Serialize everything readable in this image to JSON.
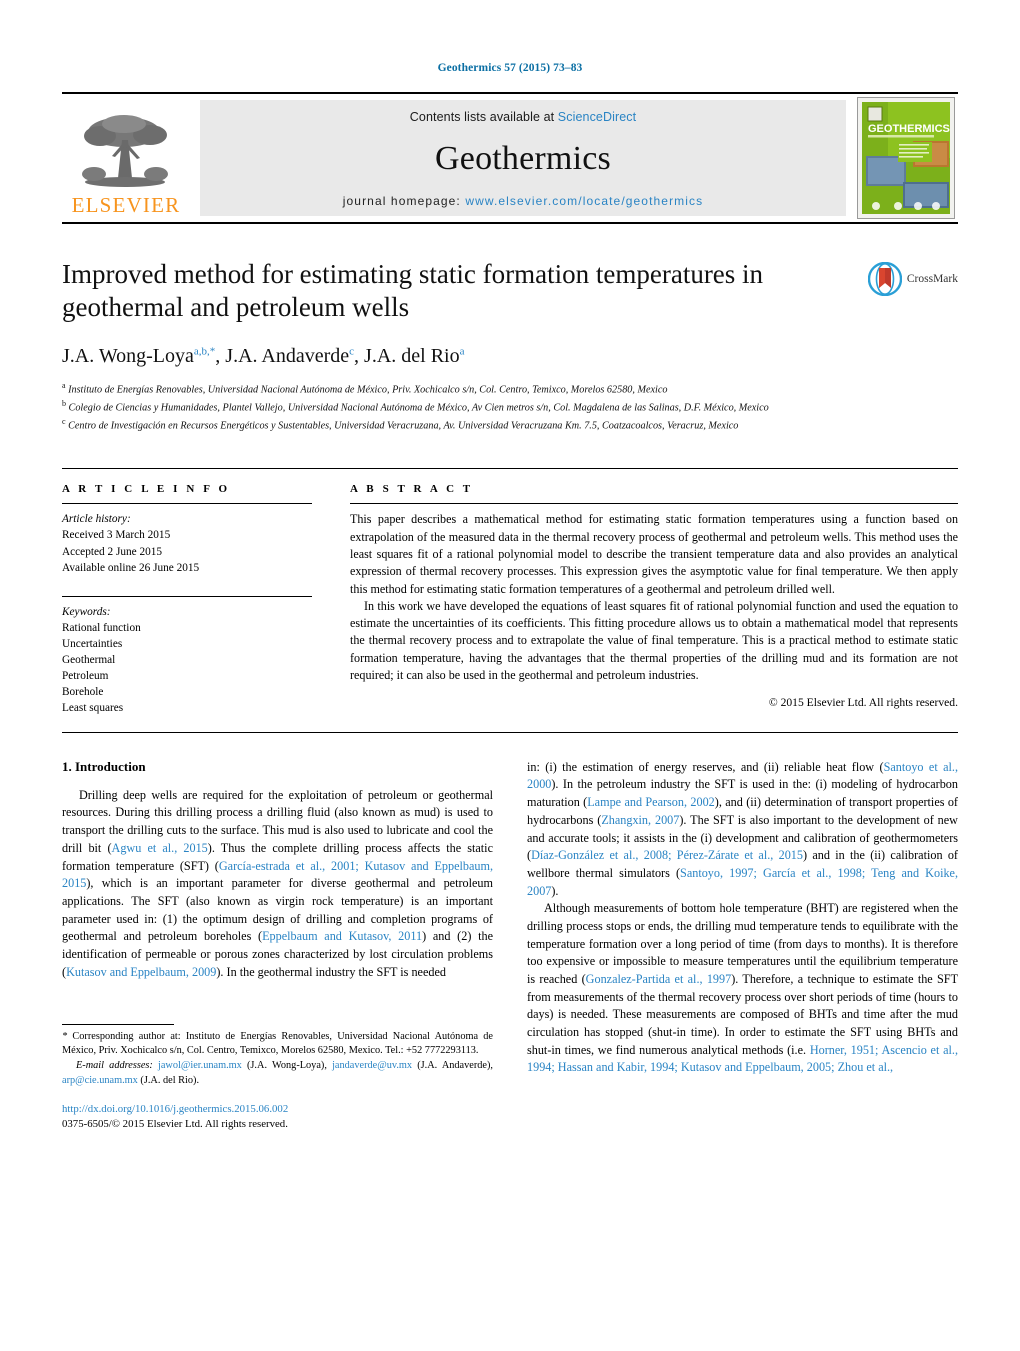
{
  "running_head": "Geothermics 57 (2015) 73–83",
  "masthead": {
    "publisher_name": "ELSEVIER",
    "contents_prefix": "Contents lists available at ",
    "contents_link": "ScienceDirect",
    "journal_name": "Geothermics",
    "homepage_prefix": "journal homepage: ",
    "homepage_url": "www.elsevier.com/locate/geothermics",
    "cover_title": "GEOTHERMICS",
    "accent_blue": "#2a84c4",
    "elsevier_orange": "#f7941e",
    "bar_gray": "#e9e9e9"
  },
  "article": {
    "title": "Improved method for estimating static formation temperatures in geothermal and petroleum wells",
    "authors_html": "J.A. Wong-Loya<sup>a,b,*</sup>, J.A. Andaverde<sup>c</sup>, J.A. del Rio<sup>a</sup>",
    "affiliations": [
      "Instituto de Energías Renovables, Universidad Nacional Autónoma de México, Priv. Xochicalco s/n, Col. Centro, Temixco, Morelos 62580, Mexico",
      "Colegio de Ciencias y Humanidades, Plantel Vallejo, Universidad Nacional Autónoma de México, Av Cien metros s/n, Col. Magdalena de las Salinas, D.F. México, Mexico",
      "Centro de Investigación en Recursos Energéticos y Sustentables, Universidad Veracruzana, Av. Universidad Veracruzana Km. 7.5, Coatzacoalcos, Veracruz, Mexico"
    ],
    "crossmark_label": "CrossMark"
  },
  "article_info": {
    "heading": "A R T I C L E   I N F O",
    "history_label": "Article history:",
    "history": [
      "Received 3 March 2015",
      "Accepted 2 June 2015",
      "Available online 26 June 2015"
    ],
    "keywords_label": "Keywords:",
    "keywords": [
      "Rational function",
      "Uncertainties",
      "Geothermal",
      "Petroleum",
      "Borehole",
      "Least squares"
    ]
  },
  "abstract": {
    "heading": "A B S T R A C T",
    "paragraphs": [
      "This paper describes a mathematical method for estimating static formation temperatures using a function based on extrapolation of the measured data in the thermal recovery process of geothermal and petroleum wells. This method uses the least squares fit of a rational polynomial model to describe the transient temperature data and also provides an analytical expression of thermal recovery processes. This expression gives the asymptotic value for final temperature. We then apply this method for estimating static formation temperatures of a geothermal and petroleum drilled well.",
      "In this work we have developed the equations of least squares fit of rational polynomial function and used the equation to estimate the uncertainties of its coefficients. This fitting procedure allows us to obtain a mathematical model that represents the thermal recovery process and to extrapolate the value of final temperature. This is a practical method to estimate static formation temperature, having the advantages that the thermal properties of the drilling mud and its formation are not required; it can also be used in the geothermal and petroleum industries."
    ],
    "copyright": "© 2015 Elsevier Ltd. All rights reserved."
  },
  "body": {
    "section_heading": "1.  Introduction",
    "left_paragraph_1_html": "Drilling deep wells are required for the exploitation of petroleum or geothermal resources. During this drilling process a drilling fluid (also known as mud) is used to transport the drilling cuts to the surface. This mud is also used to lubricate and cool the drill bit (<span class=\"cite\">Agwu et al., 2015</span>). Thus the complete drilling process affects the static formation temperature (SFT) (<span class=\"cite\">García-estrada et al., 2001; Kutasov and Eppelbaum, 2015</span>), which is an important parameter for diverse geothermal and petroleum applications. The SFT (also known as virgin rock temperature) is an important parameter used in: (1) the optimum design of drilling and completion programs of geothermal and petroleum boreholes (<span class=\"cite\">Eppelbaum and Kutasov, 2011</span>) and (2) the identification of permeable or porous zones characterized by lost circulation problems (<span class=\"cite\">Kutasov and Eppelbaum, 2009</span>). In the geothermal industry the SFT is needed",
    "right_paragraph_1_html": "in: (i) the estimation of energy reserves, and (ii) reliable heat flow (<span class=\"cite\">Santoyo et al., 2000</span>). In the petroleum industry the SFT is used in the: (i) modeling of hydrocarbon maturation (<span class=\"cite\">Lampe and Pearson, 2002</span>), and (ii) determination of transport properties of hydrocarbons (<span class=\"cite\">Zhangxin, 2007</span>). The SFT is also important to the development of new and accurate tools; it assists in the (i) development and calibration of geothermometers (<span class=\"cite\">Díaz-González et al., 2008; Pérez-Zárate et al., 2015</span>) and in the (ii) calibration of wellbore thermal simulators (<span class=\"cite\">Santoyo, 1997; García et al., 1998; Teng and Koike, 2007</span>).",
    "right_paragraph_2_html": "Although measurements of bottom hole temperature (BHT) are registered when the drilling process stops or ends, the drilling mud temperature tends to equilibrate with the temperature formation over a long period of time (from days to months). It is therefore too expensive or impossible to measure temperatures until the equilibrium temperature is reached (<span class=\"cite\">Gonzalez-Partida et al., 1997</span>). Therefore, a technique to estimate the SFT from measurements of the thermal recovery process over short periods of time (hours to days) is needed. These measurements are composed of BHTs and time after the mud circulation has stopped (shut-in time). In order to estimate the SFT using BHTs and shut-in times, we find numerous analytical methods (i.e. <span class=\"cite\">Horner, 1951; Ascencio et al., 1994; Hassan and Kabir, 1994; Kutasov and Eppelbaum, 2005; Zhou et al.,</span>"
  },
  "footnote": {
    "corresponding_html": "<span class=\"em-label\">*</span> Corresponding author at: Instituto de Energías Renovables, Universidad Nacional Autónoma de México, Priv. Xochicalco s/n, Col. Centro, Temixco, Morelos 62580, Mexico. Tel.: +52 7772293113.",
    "emails_html": "<span class=\"em-label\">E-mail addresses:</span> <span class=\"cite\">jawol@ier.unam.mx</span> (J.A. Wong-Loya), <span class=\"cite\">jandaverde@uv.mx</span> (J.A. Andaverde), <span class=\"cite\">arp@cie.unam.mx</span> (J.A. del Rio).",
    "doi": "http://dx.doi.org/10.1016/j.geothermics.2015.06.002",
    "issn": "0375-6505/© 2015 Elsevier Ltd. All rights reserved."
  }
}
